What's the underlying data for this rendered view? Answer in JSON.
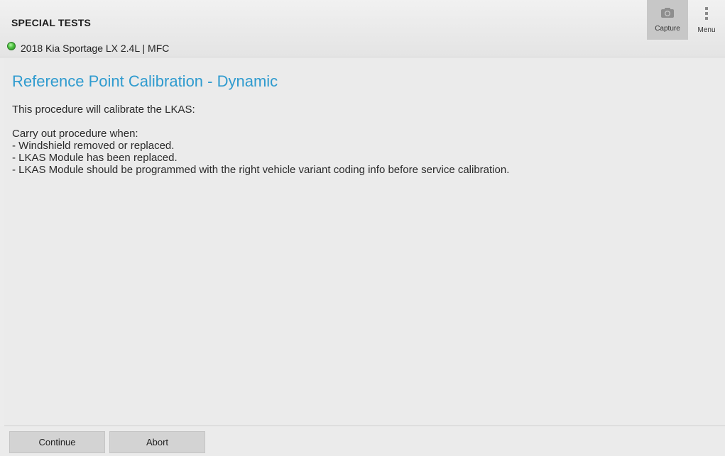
{
  "header": {
    "section_title": "SPECIAL TESTS",
    "vehicle": "2018 Kia Sportage LX 2.4L | MFC",
    "status_color": "#4cc23e"
  },
  "toolbar": {
    "capture_label": "Capture",
    "capture_icon": "camera-icon",
    "menu_label": "Menu",
    "menu_icon": "kebab-menu-icon"
  },
  "main": {
    "title": "Reference Point Calibration - Dynamic",
    "title_color": "#2f9bcf",
    "intro": "This procedure will calibrate the LKAS:",
    "conditions_heading": "Carry out procedure when:",
    "conditions": [
      "- Windshield removed or replaced.",
      "- LKAS Module has been replaced.",
      "- LKAS Module should be programmed with the right vehicle variant coding info before service calibration."
    ]
  },
  "footer": {
    "continue_label": "Continue",
    "abort_label": "Abort"
  }
}
